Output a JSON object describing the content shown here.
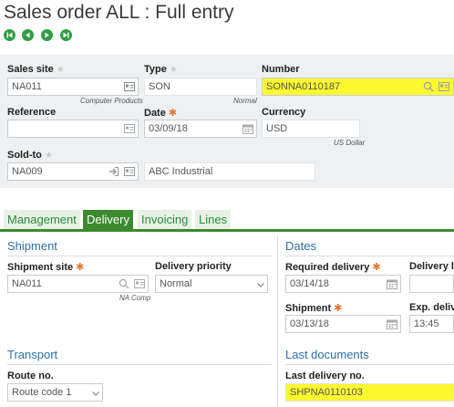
{
  "page": {
    "title": "Sales order ALL : Full entry"
  },
  "nav": {
    "buttons": [
      "first-icon",
      "previous-icon",
      "next-icon",
      "last-icon"
    ]
  },
  "header": {
    "sales_site": {
      "label": "Sales site",
      "value": "NA011",
      "sub": "Computer Products"
    },
    "type": {
      "label": "Type",
      "value": "SON",
      "sub": "Normal"
    },
    "number": {
      "label": "Number",
      "value": "SONNA0110187"
    },
    "reference": {
      "label": "Reference",
      "value": ""
    },
    "date": {
      "label": "Date",
      "value": "03/09/18"
    },
    "currency": {
      "label": "Currency",
      "value": "USD",
      "sub": "US Dollar"
    },
    "sold_to": {
      "label": "Sold-to",
      "value": "NA009",
      "name": "ABC Industrial"
    }
  },
  "tabs": [
    {
      "label": "Management",
      "active": false
    },
    {
      "label": "Delivery",
      "active": true
    },
    {
      "label": "Invoicing",
      "active": false
    },
    {
      "label": "Lines",
      "active": false
    }
  ],
  "shipment": {
    "title": "Shipment",
    "site": {
      "label": "Shipment site",
      "value": "NA011",
      "sub": "NA Comp"
    },
    "priority": {
      "label": "Delivery priority",
      "value": "Normal"
    }
  },
  "dates": {
    "title": "Dates",
    "required_delivery": {
      "label": "Required delivery",
      "value": "03/14/18"
    },
    "delivery_lead": {
      "label": "Delivery lea"
    },
    "shipment": {
      "label": "Shipment",
      "value": "03/13/18"
    },
    "exp_delivery": {
      "label": "Exp. deliver",
      "value": "13:45"
    }
  },
  "transport": {
    "title": "Transport",
    "route": {
      "label": "Route no.",
      "value": "Route code 1"
    }
  },
  "last_documents": {
    "title": "Last documents",
    "last_delivery": {
      "label": "Last delivery no.",
      "value": "SHPNA0110103"
    }
  },
  "colors": {
    "accent_green": "#3b8b2e",
    "highlight_yellow": "#fbf830",
    "section_blue": "#2c6fa8",
    "required_orange": "#e8742a"
  }
}
